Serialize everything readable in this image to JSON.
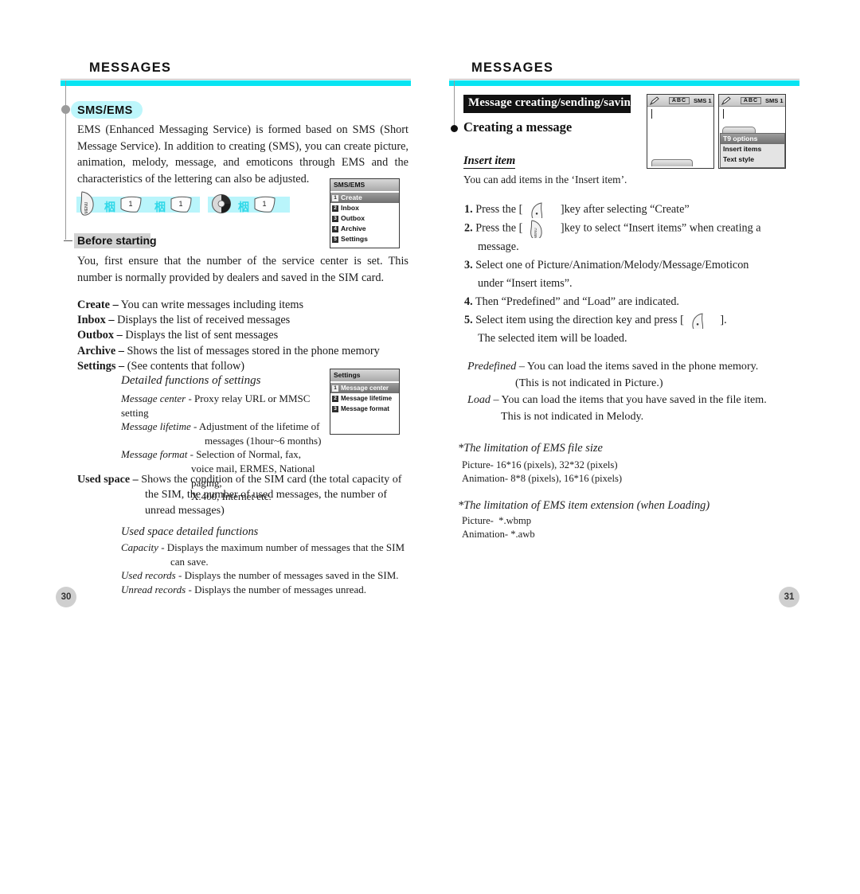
{
  "document": {
    "type": "mobile-phone-user-manual-spread"
  },
  "colors": {
    "cyan_rule": "#07e4f2",
    "pill_bg": "#bdf6fb",
    "keystrip_bg": "#b9f5fb",
    "gray_band": "#d2d2d2",
    "black_band": "#111111",
    "page_circle": "#cfcfcf"
  },
  "left_page": {
    "header": "MESSAGES",
    "page_number": "30",
    "section_pill": "SMS/EMS",
    "intro_paragraph": "EMS (Enhanced Messaging Service) is formed based on SMS (Short Message Service). In addition to creating (SMS), you can create picture, animation, melody, message, and emoticons through EMS and the characteristics of the lettering can also be adjusted.",
    "key_sequence": {
      "group_1": [
        "menu-softkey-icon",
        "arrow-glyph",
        "key-1-icon",
        "arrow-glyph",
        "key-1-icon"
      ],
      "group_2": [
        "navigation-key-icon",
        "arrow-glyph",
        "key-1-icon"
      ],
      "arrow_glyph_char": "栶",
      "key_label_1": "1",
      "menu_key_label": "MENU"
    },
    "before_starting": {
      "label": "Before starting",
      "paragraph": "You, first ensure that the number of the service center is set. This number is normally provided by dealers and saved in the SIM card."
    },
    "menu_definitions": [
      {
        "term": "Create –",
        "desc": " You can write messages including items"
      },
      {
        "term": "Inbox –",
        "desc": " Displays the list of received messages"
      },
      {
        "term": "Outbox –",
        "desc": " Displays the list of sent messages"
      },
      {
        "term": "Archive –",
        "desc": " Shows the list of messages stored in the phone memory"
      },
      {
        "term": "Settings –",
        "desc": " (See contents that follow)"
      }
    ],
    "detailed_settings": {
      "heading": "Detailed functions of settings",
      "lines": [
        {
          "term": "Message center",
          "rest": " - Proxy relay URL or MMSC setting",
          "indent": 0
        },
        {
          "term": "Message lifetime",
          "rest": " - Adjustment of the lifetime of",
          "indent": 0
        },
        {
          "term": "",
          "rest": "messages (1hour~6 months)",
          "indent": 105
        },
        {
          "term": "Message format",
          "rest": " - Selection of Normal, fax,",
          "indent": 0
        },
        {
          "term": "",
          "rest": "voice mail, ERMES, National paging,",
          "indent": 88
        },
        {
          "term": "",
          "rest": "X.400, Internet etc.",
          "indent": 88
        }
      ]
    },
    "used_space": {
      "term": "Used space –",
      "lines": [
        " Shows the condition of the SIM card (the total capacity of",
        "the SIM, the number of used messages, the number of",
        "unread messages)"
      ]
    },
    "used_space_detail": {
      "heading": "Used space detailed functions",
      "lines": [
        {
          "term": "Capacity",
          "rest": " - Displays the maximum number of messages that the SIM"
        },
        {
          "term": "",
          "rest": "can save."
        },
        {
          "term": "Used records",
          "rest": " - Displays the number of messages saved in the SIM."
        },
        {
          "term": "Unread records",
          "rest": "  - Displays the number of messages unread."
        }
      ]
    },
    "lcd_sms_ems": {
      "title": "SMS/EMS",
      "items": [
        {
          "num": "1",
          "label": "Create",
          "selected": true
        },
        {
          "num": "2",
          "label": "Inbox",
          "selected": false
        },
        {
          "num": "3",
          "label": "Outbox",
          "selected": false
        },
        {
          "num": "4",
          "label": "Archive",
          "selected": false
        },
        {
          "num": "5",
          "label": "Settings",
          "selected": false
        }
      ]
    },
    "lcd_settings": {
      "title": "Settings",
      "items": [
        {
          "num": "1",
          "label": "Message center",
          "selected": true
        },
        {
          "num": "2",
          "label": "Message lifetime",
          "selected": false
        },
        {
          "num": "3",
          "label": "Message format",
          "selected": false
        }
      ]
    }
  },
  "right_page": {
    "header": "MESSAGES",
    "page_number": "31",
    "black_band_title": "Message creating/sending/saving",
    "creating_heading": "Creating a message",
    "insert_item_heading": "Insert item",
    "insert_item_text": "You can add items in the ‘Insert item’.",
    "steps": [
      {
        "num": "1.",
        "before": "Press the [",
        "key": "ok-softkey-icon",
        "after": "]key after selecting “Create”",
        "cont": ""
      },
      {
        "num": "2.",
        "before": "Press the [",
        "key": "menu-softkey-icon",
        "after": "]key to select “Insert items” when creating a",
        "cont": "message."
      },
      {
        "num": "3.",
        "before": "Select one of Picture/Animation/Melody/Message/Emoticon",
        "key": "",
        "after": "",
        "cont": "under “Insert items”."
      },
      {
        "num": "4.",
        "before": "Then “Predefined” and “Load” are indicated.",
        "key": "",
        "after": "",
        "cont": ""
      },
      {
        "num": "5.",
        "before": "Select item using the direction key and press [",
        "key": "ok-softkey-icon",
        "after": "].",
        "cont": "The selected item will be loaded."
      }
    ],
    "definitions": [
      {
        "term": "Predefined",
        "rest": " – You can load the items saved in the phone memory.",
        "indent": 0
      },
      {
        "term": "",
        "rest": "(This is not indicated in Picture.)",
        "indent": 60
      },
      {
        "term": "Load",
        "rest": " – You can load the items that you have saved in the file item.",
        "indent": 0
      },
      {
        "term": "",
        "rest": "This is not indicated in Melody.",
        "indent": 42
      }
    ],
    "limitation_file_size": {
      "heading": "*The limitation of EMS file size",
      "lines": [
        "Picture- 16*16 (pixels), 32*32 (pixels)",
        "Animation- 8*8 (pixels), 16*16 (pixels)"
      ]
    },
    "limitation_extension": {
      "heading": "*The limitation of EMS item extension (when Loading)",
      "lines": [
        "Picture-  *.wbmp",
        "Animation- *.awb"
      ]
    },
    "lcd_editor": {
      "status_abc": "ABC",
      "status_sms": "SMS 1",
      "pencil_icon": "pencil-icon"
    },
    "lcd_editor_popup": {
      "status_abc": "ABC",
      "status_sms": "SMS 1",
      "items": [
        {
          "label": "T9 options",
          "selected": true
        },
        {
          "label": "Insert items",
          "selected": false
        },
        {
          "label": "Text style",
          "selected": false
        }
      ]
    }
  }
}
